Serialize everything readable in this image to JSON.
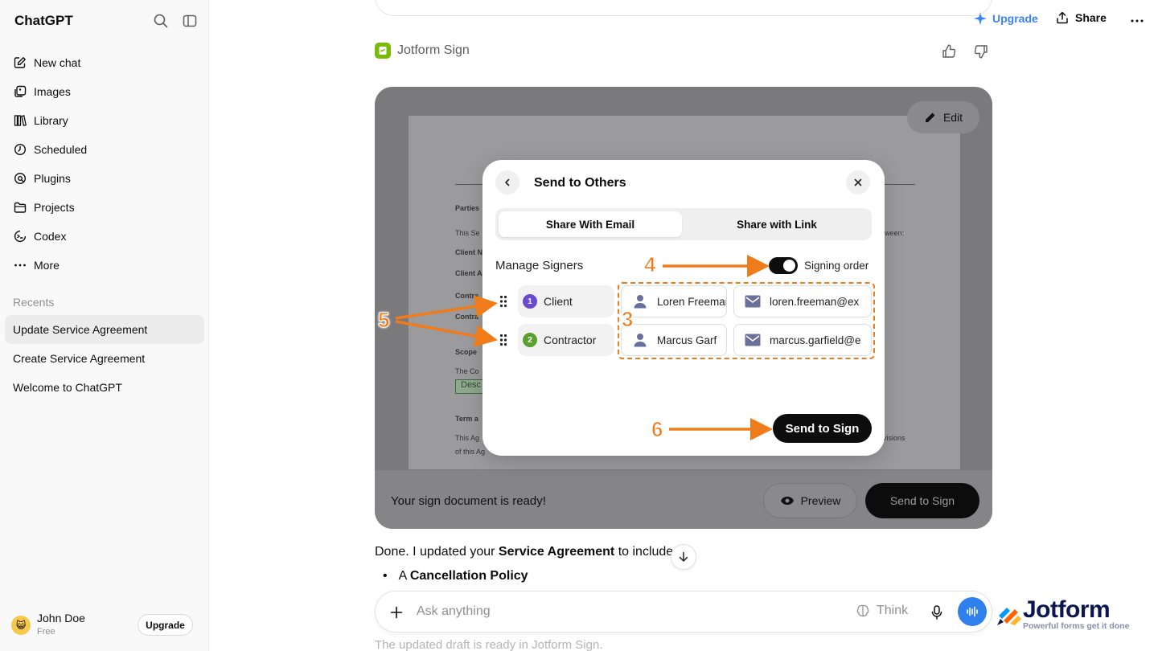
{
  "sidebar": {
    "app_title": "ChatGPT",
    "nav": [
      {
        "label": "New chat",
        "icon": "edit-icon"
      },
      {
        "label": "Images",
        "icon": "images-icon"
      },
      {
        "label": "Library",
        "icon": "library-icon"
      },
      {
        "label": "Scheduled",
        "icon": "clock-icon"
      },
      {
        "label": "Plugins",
        "icon": "plugins-icon"
      },
      {
        "label": "Projects",
        "icon": "folder-icon"
      },
      {
        "label": "Codex",
        "icon": "codex-icon"
      },
      {
        "label": "More",
        "icon": "more-icon"
      }
    ],
    "recents_label": "Recents",
    "recents": [
      {
        "label": "Update Service Agreement",
        "active": true
      },
      {
        "label": "Create Service Agreement",
        "active": false
      },
      {
        "label": "Welcome to ChatGPT",
        "active": false
      }
    ],
    "user": {
      "name": "John Doe",
      "plan": "Free",
      "upgrade_label": "Upgrade"
    }
  },
  "topbar": {
    "upgrade_label": "Upgrade",
    "share_label": "Share"
  },
  "message": {
    "plugin_name": "Jotform Sign",
    "document": {
      "lines": [
        "Parties",
        "This Se",
        "Client N",
        "Client A",
        "Contra",
        "Contra",
        "Scope",
        "The Co",
        "Term a",
        "This Ag",
        "of this Ag"
      ],
      "right_lines": [
        "ween:",
        "visions"
      ],
      "field_text": "Desc",
      "edit_label": "Edit"
    },
    "ready_text": "Your sign document is ready!",
    "preview_label": "Preview",
    "send_to_sign_label": "Send to Sign"
  },
  "modal": {
    "title": "Send to Others",
    "tabs": [
      {
        "label": "Share With Email",
        "active": true
      },
      {
        "label": "Share with Link",
        "active": false
      }
    ],
    "manage_label": "Manage Signers",
    "signing_order_label": "Signing order",
    "signing_order_enabled": true,
    "signers": [
      {
        "order": "1",
        "role": "Client",
        "badge_color": "#6c4ad0",
        "name": "Loren Freeman",
        "email": "loren.freeman@ex"
      },
      {
        "order": "2",
        "role": "Contractor",
        "badge_color": "#5aa02c",
        "name": "Marcus Garf",
        "email": "marcus.garfield@e"
      }
    ],
    "send_label": "Send to Sign"
  },
  "annotations": [
    "3",
    "4",
    "5",
    "6"
  ],
  "annotation_color": "#f07b1a",
  "reply": {
    "prefix": "Done. I updated your ",
    "bold": "Service Agreement",
    "suffix": " to include:",
    "bullet_prefix": "A ",
    "bullet_bold": "Cancellation Policy"
  },
  "composer": {
    "placeholder": "Ask anything",
    "think_label": "Think"
  },
  "faded_text": "The updated draft is ready in Jotform Sign.",
  "watermark": {
    "brand": "Jotform",
    "tagline": "Powerful forms get it done"
  }
}
